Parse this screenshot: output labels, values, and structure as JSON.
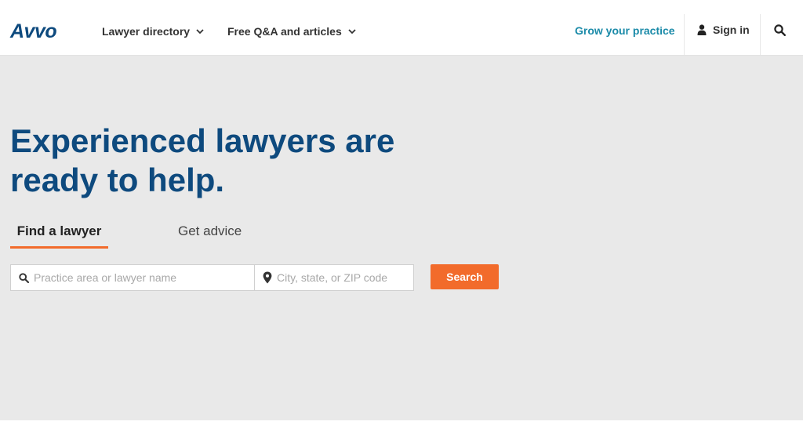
{
  "header": {
    "logo": "Avvo",
    "nav": [
      {
        "label": "Lawyer directory",
        "icon": "chevron-down-icon"
      },
      {
        "label": "Free Q&A and articles",
        "icon": "chevron-down-icon"
      }
    ],
    "grow_link": "Grow your practice",
    "signin_label": "Sign in",
    "signin_icon": "user-icon",
    "search_icon": "search-icon"
  },
  "hero": {
    "headline": "Experienced lawyers are ready to help.",
    "tabs": [
      {
        "label": "Find a lawyer",
        "active": true
      },
      {
        "label": "Get advice",
        "active": false
      }
    ],
    "practice_placeholder": "Practice area or lawyer name",
    "location_placeholder": "City, state, or ZIP code",
    "search_button": "Search"
  },
  "colors": {
    "brand_blue": "#0e4a7e",
    "accent_orange": "#f26b2b",
    "link_teal": "#1a8aa8",
    "hero_bg": "#e9e9e9"
  }
}
